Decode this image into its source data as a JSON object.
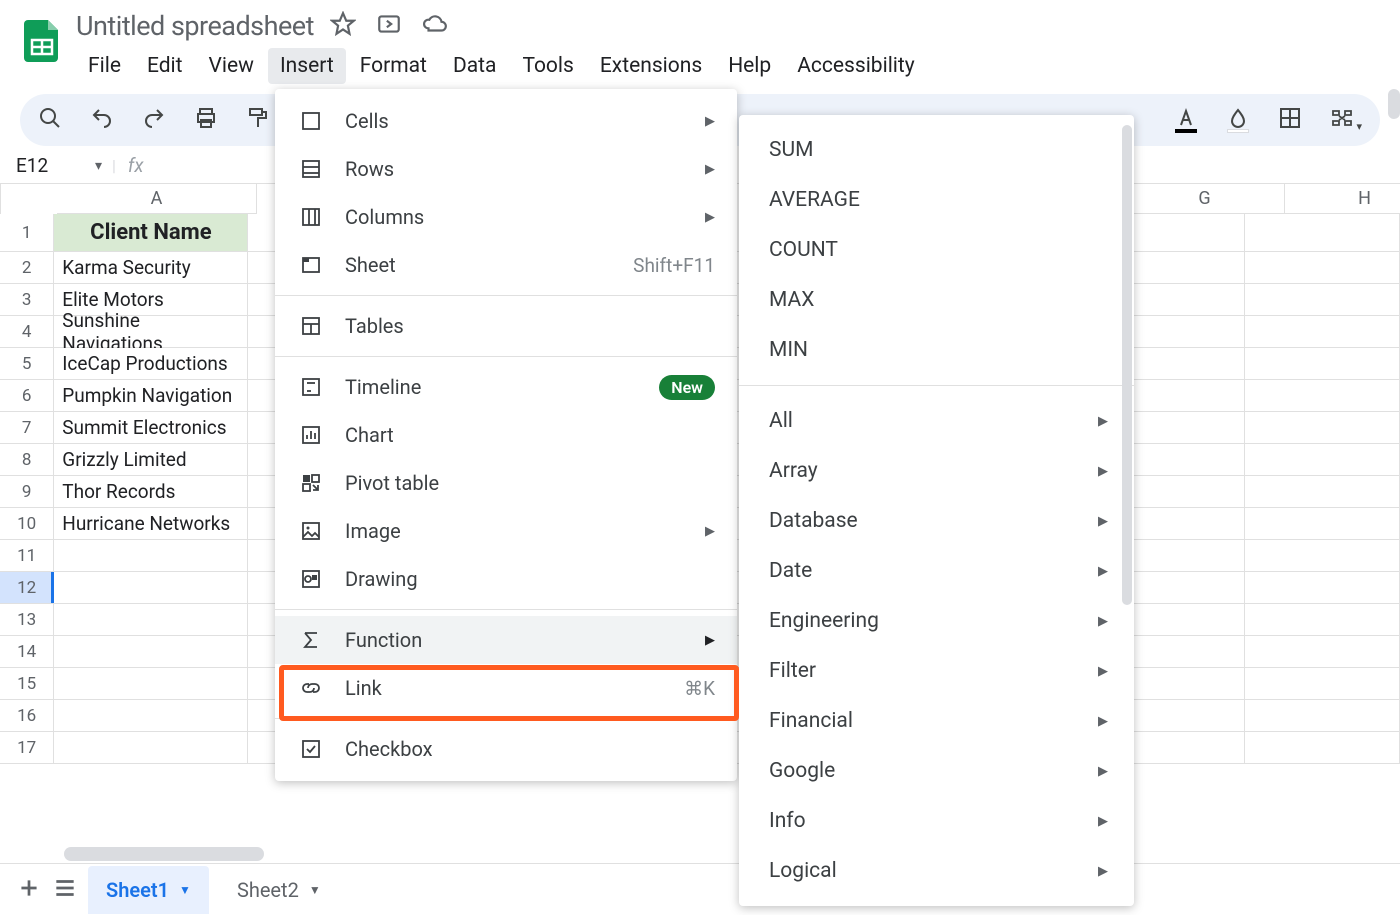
{
  "doc": {
    "title": "Untitled spreadsheet"
  },
  "menubar": [
    "File",
    "Edit",
    "View",
    "Insert",
    "Format",
    "Data",
    "Tools",
    "Extensions",
    "Help",
    "Accessibility"
  ],
  "active_menu": "Insert",
  "formula": {
    "cell_ref": "E12",
    "fx": "fx"
  },
  "columns": [
    "A",
    "G",
    "H"
  ],
  "sheet_data": {
    "header": "Client Name",
    "rows": [
      "Karma Security",
      "Elite Motors",
      "Sunshine Navigations",
      "IceCap Productions",
      "Pumpkin Navigation",
      "Summit Electronics",
      "Grizzly Limited",
      "Thor Records",
      "Hurricane Networks"
    ],
    "selected_row_num": 12
  },
  "insert_menu": {
    "group1": [
      {
        "label": "Cells",
        "arrow": true
      },
      {
        "label": "Rows",
        "arrow": true
      },
      {
        "label": "Columns",
        "arrow": true
      },
      {
        "label": "Sheet",
        "shortcut": "Shift+F11"
      }
    ],
    "group2": [
      {
        "label": "Tables"
      }
    ],
    "group3": [
      {
        "label": "Timeline",
        "badge": "New"
      },
      {
        "label": "Chart"
      },
      {
        "label": "Pivot table"
      },
      {
        "label": "Image",
        "arrow": true
      },
      {
        "label": "Drawing"
      }
    ],
    "group4": [
      {
        "label": "Function",
        "arrow": true,
        "highlighted": true
      },
      {
        "label": "Link",
        "shortcut": "⌘K"
      }
    ],
    "group5": [
      {
        "label": "Checkbox"
      }
    ]
  },
  "function_submenu": {
    "top": [
      "SUM",
      "AVERAGE",
      "COUNT",
      "MAX",
      "MIN"
    ],
    "categories": [
      "All",
      "Array",
      "Database",
      "Date",
      "Engineering",
      "Filter",
      "Financial",
      "Google",
      "Info",
      "Logical"
    ]
  },
  "sheet_tabs": {
    "active": "Sheet1",
    "other": "Sheet2"
  }
}
